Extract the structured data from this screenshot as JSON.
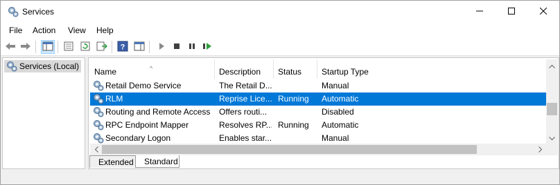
{
  "window": {
    "title": "Services"
  },
  "window_controls": {
    "minimize_icon": "minimize-icon",
    "maximize_icon": "maximize-icon",
    "close_icon": "close-icon"
  },
  "menu": {
    "items": [
      "File",
      "Action",
      "View",
      "Help"
    ]
  },
  "toolbar": {
    "buttons": [
      "back-arrow-icon",
      "forward-arrow-icon",
      "show-hide-console-tree-icon",
      "properties-icon",
      "refresh-icon",
      "export-list-icon",
      "help-icon",
      "show-hide-action-pane-icon",
      "start-icon",
      "stop-icon",
      "pause-icon",
      "restart-icon"
    ]
  },
  "tree": {
    "root_label": "Services (Local)"
  },
  "table": {
    "columns": [
      "Name",
      "Description",
      "Status",
      "Startup Type"
    ],
    "sort_indicator": "^",
    "rows": [
      {
        "name": "Retail Demo Service",
        "description": "The Retail D...",
        "status": "",
        "startup": "Manual",
        "selected": false
      },
      {
        "name": "RLM",
        "description": "Reprise Lice...",
        "status": "Running",
        "startup": "Automatic",
        "selected": true
      },
      {
        "name": "Routing and Remote Access",
        "description": "Offers routi...",
        "status": "",
        "startup": "Disabled",
        "selected": false
      },
      {
        "name": "RPC Endpoint Mapper",
        "description": "Resolves RP...",
        "status": "Running",
        "startup": "Automatic",
        "selected": false
      },
      {
        "name": "Secondary Logon",
        "description": "Enables star...",
        "status": "",
        "startup": "Manual",
        "selected": false
      }
    ]
  },
  "tabs": {
    "extended": "Extended",
    "standard": "Standard",
    "active": "Standard"
  },
  "colors": {
    "selection": "#0078d7",
    "tree_selected": "#d9d9d9",
    "start_green": "#2e9e3e"
  }
}
